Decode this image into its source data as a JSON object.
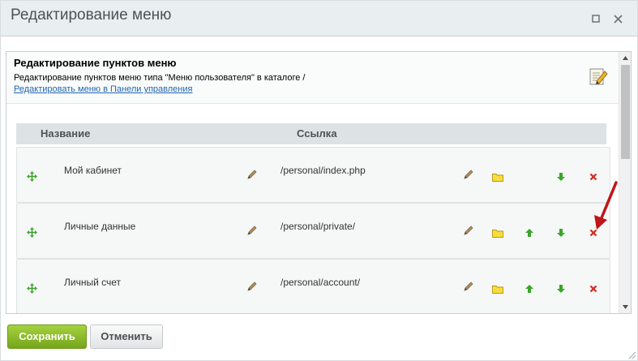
{
  "window": {
    "title": "Редактирование меню"
  },
  "form": {
    "title": "Редактирование пунктов меню",
    "description": "Редактирование пунктов меню типа \"Меню пользователя\" в каталоге /",
    "control_panel_link": "Редактировать меню в Панели управления"
  },
  "table": {
    "columns": {
      "name": "Название",
      "link": "Ссылка"
    },
    "rows": [
      {
        "name": "Мой кабинет",
        "link": "/personal/index.php"
      },
      {
        "name": "Личные данные",
        "link": "/personal/private/"
      },
      {
        "name": "Личный счет",
        "link": "/personal/account/"
      }
    ]
  },
  "buttons": {
    "save": "Сохранить",
    "cancel": "Отменить"
  },
  "icons": {
    "maximize": "maximize-icon",
    "close": "close-icon",
    "edit_doc": "edit-document-icon",
    "drag": "drag-move-icon",
    "pencil": "pencil-icon",
    "folder": "folder-icon",
    "move_up": "arrow-up-icon",
    "move_down": "arrow-down-icon",
    "delete": "delete-x-icon"
  },
  "colors": {
    "save_button": "#8cbf2a",
    "delete": "#d9261c",
    "arrows": "#3aa52a",
    "link": "#2067b0",
    "folder": "#f2d022",
    "annotation_arrow": "#c0141a"
  }
}
